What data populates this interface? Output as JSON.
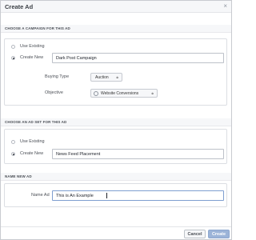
{
  "dialog": {
    "title": "Create Ad",
    "close_glyph": "×"
  },
  "campaign": {
    "heading": "CHOOSE A CAMPAIGN FOR THIS AD",
    "use_existing_label": "Use Existing",
    "create_new_label": "Create New",
    "campaign_name_value": "Dark Post Campaign",
    "buying_type_label": "Buying Type",
    "buying_type_value": "Auction",
    "objective_label": "Objective",
    "objective_value": "Website Conversions",
    "caret": "≑"
  },
  "ad_set": {
    "heading": "CHOOSE AN AD SET FOR THIS AD",
    "use_existing_label": "Use Existing",
    "create_new_label": "Create New",
    "ad_set_name_value": "News Feed Placement"
  },
  "ad": {
    "heading": "NAME NEW AD",
    "name_label": "Name Ad",
    "name_value": "This is An Example"
  },
  "footer": {
    "cancel_label": "Cancel",
    "create_label": "Create"
  }
}
